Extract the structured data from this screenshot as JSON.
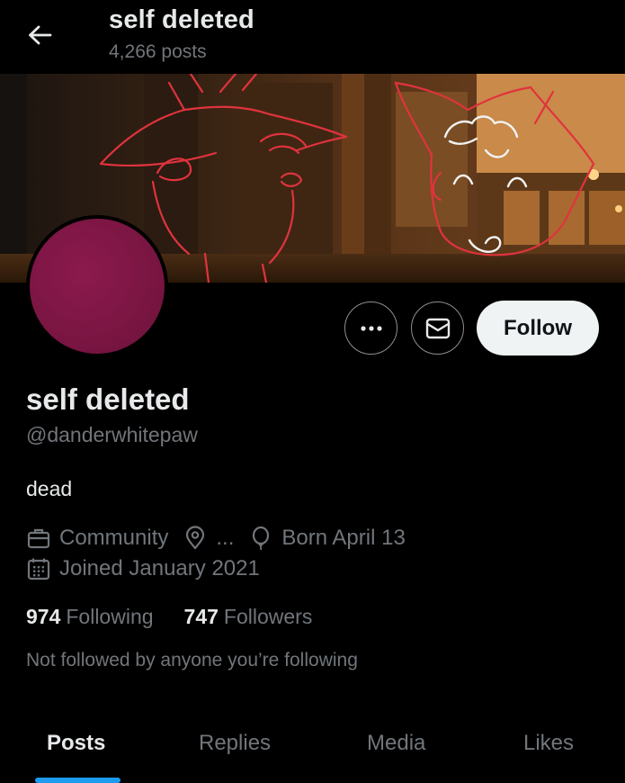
{
  "header": {
    "title": "self deleted",
    "post_count": "4,266 posts",
    "back_icon": "arrow-left-icon"
  },
  "profile": {
    "display_name": "self deleted",
    "handle": "@danderwhitepaw",
    "bio": "dead",
    "avatar_color": "#7a1542",
    "category": "Community",
    "location": "...",
    "birthday": "Born April 13",
    "joined": "Joined January 2021",
    "following_count": "974",
    "following_label": "Following",
    "followers_count": "747",
    "followers_label": "Followers",
    "not_followed_text": "Not followed by anyone you’re following"
  },
  "actions": {
    "more_icon": "more-icon",
    "message_icon": "envelope-icon",
    "follow_label": "Follow"
  },
  "tabs": [
    {
      "label": "Posts",
      "active": true
    },
    {
      "label": "Replies",
      "active": false
    },
    {
      "label": "Media",
      "active": false
    },
    {
      "label": "Likes",
      "active": false
    }
  ],
  "colors": {
    "background": "#000000",
    "primary_text": "#e7e9ea",
    "secondary_text": "#71767b",
    "accent": "#1d9bf0",
    "follow_button_bg": "#eff3f4",
    "banner_doodle": "#e0333d"
  }
}
